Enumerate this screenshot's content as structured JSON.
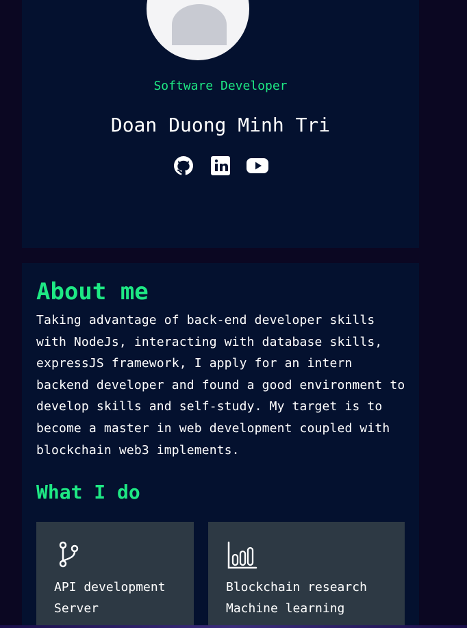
{
  "profile": {
    "role": "Software Developer",
    "name": "Doan Duong Minh Tri",
    "social_links": [
      {
        "icon": "github-icon"
      },
      {
        "icon": "linkedin-icon"
      },
      {
        "icon": "youtube-icon"
      }
    ]
  },
  "about": {
    "title": "About me",
    "text": "Taking advantage of back-end developer skills with NodeJs, interacting with database skills, expressJS framework, I apply for an intern backend developer and found a good environment to develop skills and self-study. My target is to become a master in web development coupled with blockchain web3 implements."
  },
  "services": {
    "title": "What I do",
    "items": [
      {
        "icon": "git-branch-icon",
        "lines": [
          "API development",
          "Server"
        ]
      },
      {
        "icon": "bar-chart-icon",
        "lines": [
          "Blockchain research",
          "Machine learning"
        ]
      }
    ]
  },
  "colors": {
    "background": "#0b0722",
    "card": "#04112f",
    "accent": "#1ee884",
    "service_card": "#2d3944",
    "text": "#ffffff"
  }
}
